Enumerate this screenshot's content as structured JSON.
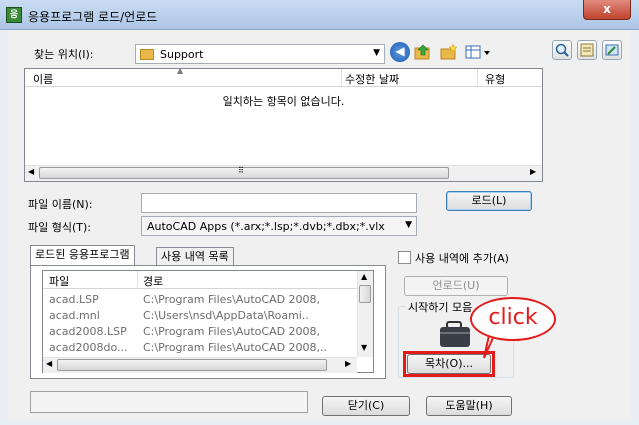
{
  "window": {
    "title": "응용프로그램 로드/언로드",
    "app_icon_text": "응",
    "close_glyph": "x"
  },
  "lookin": {
    "label": "찾는 위치(I):",
    "value": "Support"
  },
  "file_list": {
    "columns": [
      "이름",
      "수정한 날짜",
      "유형"
    ],
    "empty_message": "일치하는 항목이 없습니다.",
    "scroll_glyph": "⠿"
  },
  "filename": {
    "label": "파일 이름(N):",
    "value": ""
  },
  "filetype": {
    "label": "파일 형식(T):",
    "value": "AutoCAD Apps (*.arx;*.lsp;*.dvb;*.dbx;*.vlx"
  },
  "buttons": {
    "load": "로드(L)",
    "unload": "언로드(U)",
    "contents": "목차(O)...",
    "close": "닫기(C)",
    "help": "도움말(H)"
  },
  "tabs": [
    "로드된 응용프로그램",
    "사용 내역 목록"
  ],
  "add_history": "사용 내역에 추가(A)",
  "startup_group": "시작하기 모음",
  "loaded_list": {
    "columns": [
      "파일",
      "경로"
    ],
    "rows": [
      {
        "file": "acad.LSP",
        "path": "C:\\Program Files\\AutoCAD 2008,"
      },
      {
        "file": "acad.mnl",
        "path": "C:\\Users\\nsd\\AppData\\Roami.."
      },
      {
        "file": "acad2008.LSP",
        "path": "C:\\Program Files\\AutoCAD 2008,"
      },
      {
        "file": "acad2008do...",
        "path": "C:\\Program Files\\AutoCAD 2008,.."
      }
    ]
  },
  "status_text": "",
  "annotation": {
    "callout": "click",
    "color": "#e31b1b"
  },
  "colors": {
    "titlebar": "#b9d0ec",
    "window_bg": "#f0f0f0",
    "folder": "#e8b84a"
  },
  "icons": [
    "back-icon",
    "up-folder-icon",
    "new-folder-icon",
    "view-menu-icon",
    "find-icon",
    "properties-icon",
    "tool-icon"
  ]
}
